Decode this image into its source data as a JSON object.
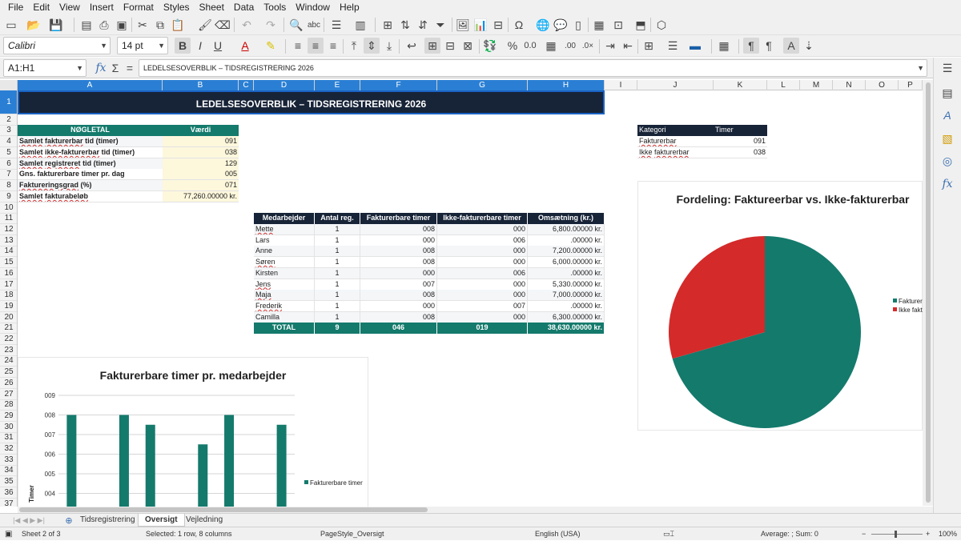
{
  "menu": [
    "File",
    "Edit",
    "View",
    "Insert",
    "Format",
    "Styles",
    "Sheet",
    "Data",
    "Tools",
    "Window",
    "Help"
  ],
  "format_bar": {
    "font_name": "Calibri",
    "font_size": "14 pt"
  },
  "formula_bar": {
    "name_box": "A1:H1",
    "formula": "LEDELSESOVERBLIK – TIDSREGISTRERING 2026"
  },
  "columns": [
    "A",
    "B",
    "C",
    "D",
    "E",
    "F",
    "G",
    "H",
    "I",
    "J",
    "K",
    "L",
    "M",
    "N",
    "O",
    "P"
  ],
  "rows": [
    "1",
    "2",
    "3",
    "4",
    "5",
    "6",
    "7",
    "8",
    "9",
    "10",
    "11",
    "12",
    "13",
    "14",
    "15",
    "16",
    "17",
    "18",
    "19",
    "20",
    "21",
    "22",
    "23",
    "24",
    "25",
    "26",
    "27",
    "28",
    "29",
    "30",
    "31",
    "32",
    "33",
    "34",
    "35",
    "36",
    "37"
  ],
  "sheet": {
    "title": "LEDELSESOVERBLIK – TIDSREGISTRERING 2026",
    "kpi": {
      "headers": [
        "NØGLETAL",
        "Værdi"
      ],
      "rows": [
        {
          "label": "Samlet fakturerbar tid (timer)",
          "value": "091"
        },
        {
          "label": "Samlet ikke-fakturerbar tid (timer)",
          "value": "038"
        },
        {
          "label": "Samlet registreret tid (timer)",
          "value": "129"
        },
        {
          "label": "Gns. fakturerbare timer pr. dag",
          "value": "005"
        },
        {
          "label": "Faktureringsgrad (%)",
          "value": "071"
        },
        {
          "label": "Samlet fakturabeløb",
          "value": "77,260.00000 kr."
        }
      ]
    },
    "category": {
      "headers": [
        "Kategori",
        "Timer"
      ],
      "rows": [
        {
          "label": "Fakturerbar",
          "value": "091"
        },
        {
          "label": "Ikke fakturerbar",
          "value": "038"
        }
      ]
    },
    "employees": {
      "headers": [
        "Medarbejder",
        "Antal reg.",
        "Fakturerbare timer",
        "Ikke-fakturerbare timer",
        "Omsætning (kr.)"
      ],
      "rows": [
        [
          "Mette",
          "1",
          "008",
          "000",
          "6,800.00000 kr."
        ],
        [
          "Lars",
          "1",
          "000",
          "006",
          ".00000 kr."
        ],
        [
          "Anne",
          "1",
          "008",
          "000",
          "7,200.00000 kr."
        ],
        [
          "Søren",
          "1",
          "008",
          "000",
          "6,000.00000 kr."
        ],
        [
          "Kirsten",
          "1",
          "000",
          "006",
          ".00000 kr."
        ],
        [
          "Jens",
          "1",
          "007",
          "000",
          "5,330.00000 kr."
        ],
        [
          "Maja",
          "1",
          "008",
          "000",
          "7,000.00000 kr."
        ],
        [
          "Frederik",
          "1",
          "000",
          "007",
          ".00000 kr."
        ],
        [
          "Camilla",
          "1",
          "008",
          "000",
          "6,300.00000 kr."
        ]
      ],
      "total": [
        "TOTAL",
        "9",
        "046",
        "019",
        "38,630.00000 kr."
      ]
    }
  },
  "chart_data": [
    {
      "type": "pie",
      "title": "Fordeling: Faktureerbar vs. Ikke-fakturerbar",
      "categories": [
        "Fakturerbar",
        "Ikke fakturerbar"
      ],
      "values": [
        91,
        38
      ],
      "legend_labels": [
        "Fakturer",
        "Ikke fakt"
      ],
      "colors": [
        "#147a6c",
        "#d42a2a"
      ],
      "legend": "right"
    },
    {
      "type": "bar",
      "title": "Fakturerbare timer pr. medarbejder",
      "categories": [
        "Mette",
        "Lars",
        "Anne",
        "Søren",
        "Kirsten",
        "Jens",
        "Maja",
        "Frederik",
        "Camilla"
      ],
      "series": [
        {
          "name": "Fakturerbare timer",
          "values": [
            8,
            0,
            8,
            7.5,
            0,
            6.5,
            8,
            0,
            7.5
          ]
        }
      ],
      "ylabel": "Timer",
      "ylim": [
        3.5,
        9
      ],
      "yticks": [
        "009",
        "008",
        "007",
        "006",
        "005",
        "004"
      ],
      "color": "#147a6c",
      "legend": "right"
    }
  ],
  "tabs": [
    "Tidsregistrering",
    "Oversigt",
    "Vejledning"
  ],
  "active_tab": "Oversigt",
  "status": {
    "sheet": "Sheet 2 of 3",
    "selection": "Selected: 1 row, 8 columns",
    "pagestyle": "PageStyle_Oversigt",
    "language": "English (USA)",
    "sum": "Average: ; Sum: 0",
    "zoom": "100%"
  }
}
